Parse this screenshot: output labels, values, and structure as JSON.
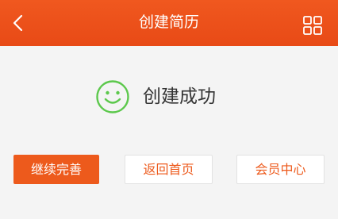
{
  "header": {
    "title": "创建简历",
    "back_icon": "chevron-left-icon",
    "menu_icon": "grid-icon",
    "color": "#ec521b"
  },
  "status": {
    "icon": "smile-icon",
    "icon_color": "#5cc84c",
    "text": "创建成功"
  },
  "actions": {
    "continue_label": "继续完善",
    "home_label": "返回首页",
    "member_label": "会员中心",
    "accent_color": "#ed5a1c"
  }
}
